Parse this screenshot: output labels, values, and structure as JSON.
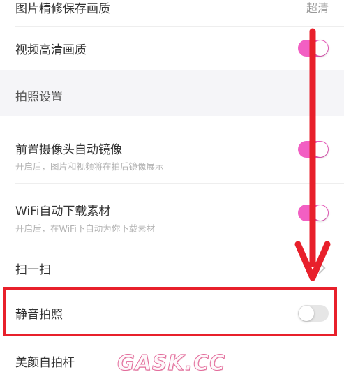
{
  "settings": {
    "items": [
      {
        "label": "图片精修保存画质",
        "value": "超清"
      },
      {
        "label": "视频高清画质",
        "toggle": "on"
      },
      {
        "section": "拍照设置"
      },
      {
        "label": "前置摄像头自动镜像",
        "sub": "开启后，图片和视频将在拍后镜像展示",
        "toggle": "on"
      },
      {
        "label": "WiFi自动下载素材",
        "sub": "开启后，在WiFi下自动为你下载素材",
        "toggle": "on"
      },
      {
        "label": "扫一扫",
        "chevron": true
      },
      {
        "label": "静音拍照",
        "toggle": "off"
      },
      {
        "label": "美颜自拍杆"
      }
    ]
  },
  "overlay": {
    "watermark": "GASK.CC",
    "annotation_color": "#e8202b"
  },
  "colors": {
    "toggle_on": "#f25fc3",
    "toggle_off": "#e6e6e6",
    "section_bg": "#f5f5f8"
  }
}
